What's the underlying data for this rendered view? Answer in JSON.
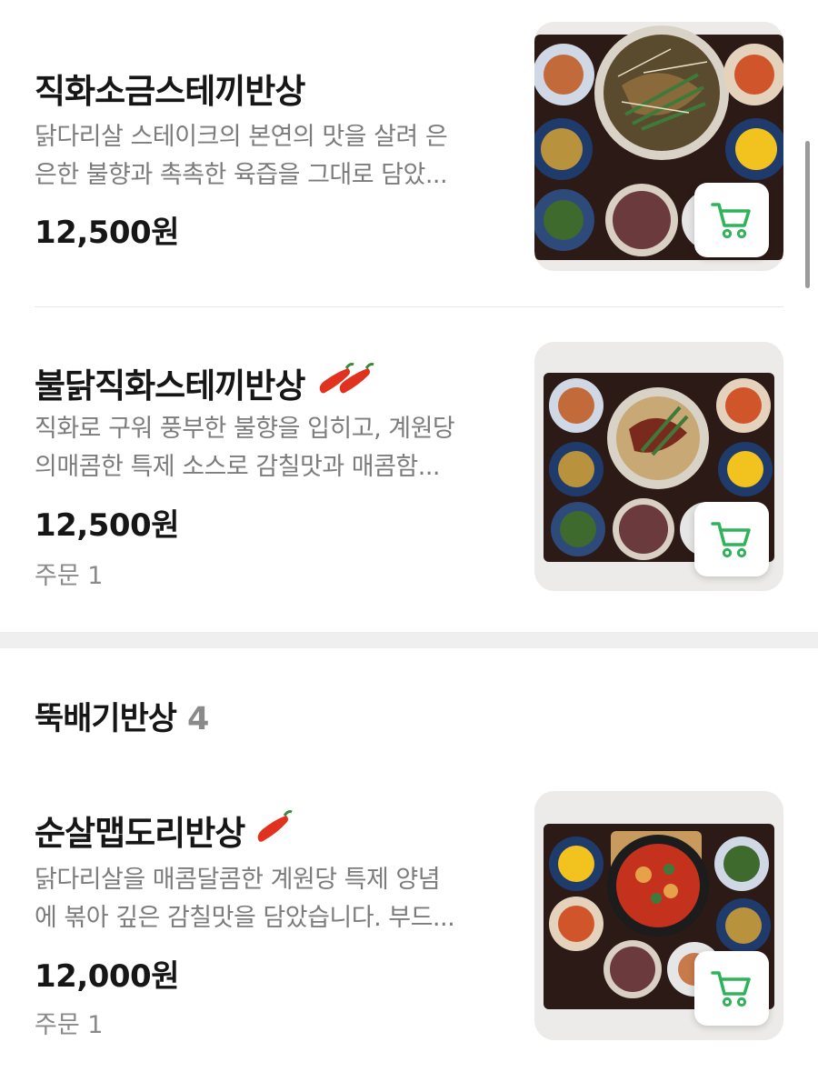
{
  "items": [
    {
      "name": "직화소금스테끼반상",
      "desc_line1": "닭다리살 스테이크의 본연의 맛을 살려 은",
      "desc_line2": "은한 불향과 촉촉한 육즙을 그대로 담았...",
      "price": "12,500원",
      "orders": ""
    },
    {
      "name": "불닭직화스테끼반상",
      "desc_line1": "직화로 구워 풍부한 불향을 입히고, 계원당",
      "desc_line2": "의매콤한 특제 소스로 감칠맛과 매콤함...",
      "price": "12,500원",
      "orders": "주문 1"
    },
    {
      "name": "순살맵도리반상",
      "desc_line1": "닭다리살을 매콤달콤한 계원당 특제 양념",
      "desc_line2": "에 볶아 깊은 감칠맛을 담았습니다. 부드...",
      "price": "12,000원",
      "orders": "주문 1"
    }
  ],
  "section": {
    "title": "뚝배기반상",
    "count": "4"
  },
  "colors": {
    "cart_green": "#2fb35a",
    "pepper_red": "#e0321f",
    "tray": "#2c1a16"
  },
  "icons": [
    "cart-icon",
    "chili-pepper-icon"
  ]
}
